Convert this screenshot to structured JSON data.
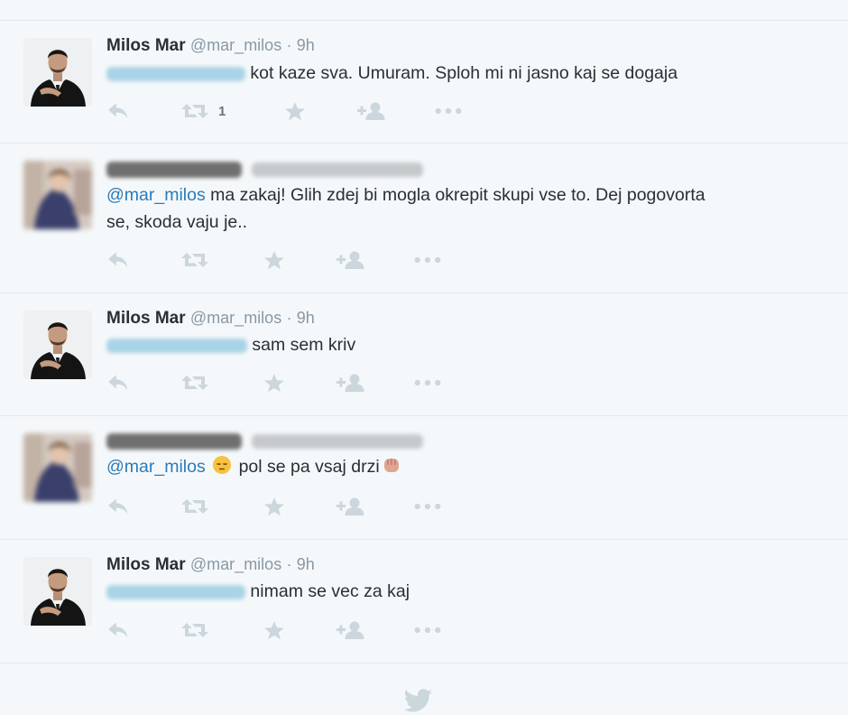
{
  "tweets": [
    {
      "name": "Milos Mar",
      "handle": "@mar_milos",
      "separator": "·",
      "time": "9h",
      "text": "kot kaze sva. Umuram. Sploh mi ni jasno kaj se dogaja",
      "retweet_count": "1"
    },
    {
      "mention": "@mar_milos",
      "text_line1": "ma zakaj! Glih zdej bi mogla okrepit skupi vse to. Dej pogovorta",
      "text_line2": "se, skoda vaju je.."
    },
    {
      "name": "Milos Mar",
      "handle": "@mar_milos",
      "separator": "·",
      "time": "9h",
      "text": "sam sem kriv"
    },
    {
      "mention": "@mar_milos",
      "emoji_1": "pensive-face-emoji",
      "text": "pol se pa vsaj drzi",
      "emoji_2": "raised-fist-emoji"
    },
    {
      "name": "Milos Mar",
      "handle": "@mar_milos",
      "separator": "·",
      "time": "9h",
      "text": "nimam se vec za kaj"
    }
  ],
  "colors": {
    "background": "#f5f8fa",
    "divider": "#e1e8ed",
    "link": "#2b7bb9",
    "icon": "#ccd6dd",
    "secondary_text": "#8899a6"
  },
  "icons": [
    "reply-icon",
    "retweet-icon",
    "favorite-icon",
    "follow-icon",
    "more-icon",
    "twitter-bird-icon"
  ]
}
